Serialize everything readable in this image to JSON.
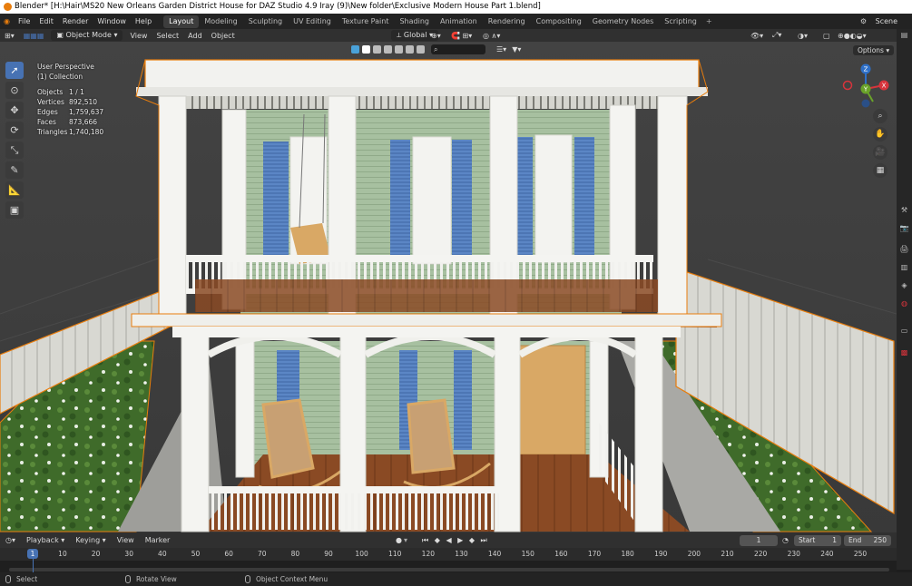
{
  "title_bar": {
    "text": "Blender* [H:\\Hair\\MS20 New Orleans Garden District House for DAZ Studio 4.9 Iray  (9)\\New folder\\Exclusive Modern House Part 1.blend]"
  },
  "top_menu": {
    "items": [
      "File",
      "Edit",
      "Render",
      "Window",
      "Help"
    ],
    "workspaces": [
      "Layout",
      "Modeling",
      "Sculpting",
      "UV Editing",
      "Texture Paint",
      "Shading",
      "Animation",
      "Rendering",
      "Compositing",
      "Geometry Nodes",
      "Scripting"
    ],
    "active_workspace": "Layout",
    "add_workspace": "+",
    "scene_label": "Scene"
  },
  "viewport_header": {
    "mode": "Object Mode",
    "menus": [
      "View",
      "Select",
      "Add",
      "Object"
    ],
    "transform_orientation": "Global",
    "options_label": "Options"
  },
  "viewport_overlay": {
    "view_name": "User Perspective",
    "collection": "(1) Collection",
    "stats": [
      {
        "label": "Objects",
        "value": "1 / 1"
      },
      {
        "label": "Vertices",
        "value": "892,510"
      },
      {
        "label": "Edges",
        "value": "1,759,637"
      },
      {
        "label": "Faces",
        "value": "873,666"
      },
      {
        "label": "Triangles",
        "value": "1,740,180"
      }
    ]
  },
  "gizmo": {
    "x": "X",
    "y": "Y",
    "z": "Z"
  },
  "timeline": {
    "menus": [
      "Playback",
      "Keying",
      "View",
      "Marker"
    ],
    "current_frame": "1",
    "start_label": "Start",
    "start_value": "1",
    "end_label": "End",
    "end_value": "250",
    "ruler_ticks": [
      "10",
      "20",
      "30",
      "40",
      "50",
      "60",
      "70",
      "80",
      "90",
      "100",
      "110",
      "120",
      "130",
      "140",
      "150",
      "160",
      "170",
      "180",
      "190",
      "200",
      "210",
      "220",
      "230",
      "240",
      "250"
    ],
    "ruler_current": "1"
  },
  "status_bar": {
    "select": "Select",
    "rotate": "Rotate View",
    "context": "Object Context Menu"
  },
  "colors": {
    "accent": "#4772b3",
    "selection_outline": "#e87d0d",
    "siding": "#a9c2a2",
    "shutters": "#5b86c5",
    "floor": "#8a4a24"
  }
}
